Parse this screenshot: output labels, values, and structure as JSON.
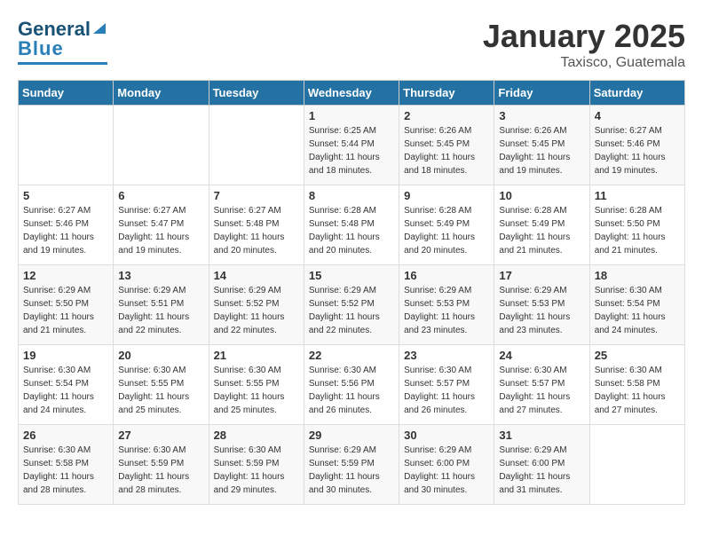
{
  "header": {
    "logo_general": "General",
    "logo_blue": "Blue",
    "title": "January 2025",
    "location": "Taxisco, Guatemala"
  },
  "days_of_week": [
    "Sunday",
    "Monday",
    "Tuesday",
    "Wednesday",
    "Thursday",
    "Friday",
    "Saturday"
  ],
  "weeks": [
    [
      {
        "day": "",
        "info": ""
      },
      {
        "day": "",
        "info": ""
      },
      {
        "day": "",
        "info": ""
      },
      {
        "day": "1",
        "info": "Sunrise: 6:25 AM\nSunset: 5:44 PM\nDaylight: 11 hours and 18 minutes."
      },
      {
        "day": "2",
        "info": "Sunrise: 6:26 AM\nSunset: 5:45 PM\nDaylight: 11 hours and 18 minutes."
      },
      {
        "day": "3",
        "info": "Sunrise: 6:26 AM\nSunset: 5:45 PM\nDaylight: 11 hours and 19 minutes."
      },
      {
        "day": "4",
        "info": "Sunrise: 6:27 AM\nSunset: 5:46 PM\nDaylight: 11 hours and 19 minutes."
      }
    ],
    [
      {
        "day": "5",
        "info": "Sunrise: 6:27 AM\nSunset: 5:46 PM\nDaylight: 11 hours and 19 minutes."
      },
      {
        "day": "6",
        "info": "Sunrise: 6:27 AM\nSunset: 5:47 PM\nDaylight: 11 hours and 19 minutes."
      },
      {
        "day": "7",
        "info": "Sunrise: 6:27 AM\nSunset: 5:48 PM\nDaylight: 11 hours and 20 minutes."
      },
      {
        "day": "8",
        "info": "Sunrise: 6:28 AM\nSunset: 5:48 PM\nDaylight: 11 hours and 20 minutes."
      },
      {
        "day": "9",
        "info": "Sunrise: 6:28 AM\nSunset: 5:49 PM\nDaylight: 11 hours and 20 minutes."
      },
      {
        "day": "10",
        "info": "Sunrise: 6:28 AM\nSunset: 5:49 PM\nDaylight: 11 hours and 21 minutes."
      },
      {
        "day": "11",
        "info": "Sunrise: 6:28 AM\nSunset: 5:50 PM\nDaylight: 11 hours and 21 minutes."
      }
    ],
    [
      {
        "day": "12",
        "info": "Sunrise: 6:29 AM\nSunset: 5:50 PM\nDaylight: 11 hours and 21 minutes."
      },
      {
        "day": "13",
        "info": "Sunrise: 6:29 AM\nSunset: 5:51 PM\nDaylight: 11 hours and 22 minutes."
      },
      {
        "day": "14",
        "info": "Sunrise: 6:29 AM\nSunset: 5:52 PM\nDaylight: 11 hours and 22 minutes."
      },
      {
        "day": "15",
        "info": "Sunrise: 6:29 AM\nSunset: 5:52 PM\nDaylight: 11 hours and 22 minutes."
      },
      {
        "day": "16",
        "info": "Sunrise: 6:29 AM\nSunset: 5:53 PM\nDaylight: 11 hours and 23 minutes."
      },
      {
        "day": "17",
        "info": "Sunrise: 6:29 AM\nSunset: 5:53 PM\nDaylight: 11 hours and 23 minutes."
      },
      {
        "day": "18",
        "info": "Sunrise: 6:30 AM\nSunset: 5:54 PM\nDaylight: 11 hours and 24 minutes."
      }
    ],
    [
      {
        "day": "19",
        "info": "Sunrise: 6:30 AM\nSunset: 5:54 PM\nDaylight: 11 hours and 24 minutes."
      },
      {
        "day": "20",
        "info": "Sunrise: 6:30 AM\nSunset: 5:55 PM\nDaylight: 11 hours and 25 minutes."
      },
      {
        "day": "21",
        "info": "Sunrise: 6:30 AM\nSunset: 5:55 PM\nDaylight: 11 hours and 25 minutes."
      },
      {
        "day": "22",
        "info": "Sunrise: 6:30 AM\nSunset: 5:56 PM\nDaylight: 11 hours and 26 minutes."
      },
      {
        "day": "23",
        "info": "Sunrise: 6:30 AM\nSunset: 5:57 PM\nDaylight: 11 hours and 26 minutes."
      },
      {
        "day": "24",
        "info": "Sunrise: 6:30 AM\nSunset: 5:57 PM\nDaylight: 11 hours and 27 minutes."
      },
      {
        "day": "25",
        "info": "Sunrise: 6:30 AM\nSunset: 5:58 PM\nDaylight: 11 hours and 27 minutes."
      }
    ],
    [
      {
        "day": "26",
        "info": "Sunrise: 6:30 AM\nSunset: 5:58 PM\nDaylight: 11 hours and 28 minutes."
      },
      {
        "day": "27",
        "info": "Sunrise: 6:30 AM\nSunset: 5:59 PM\nDaylight: 11 hours and 28 minutes."
      },
      {
        "day": "28",
        "info": "Sunrise: 6:30 AM\nSunset: 5:59 PM\nDaylight: 11 hours and 29 minutes."
      },
      {
        "day": "29",
        "info": "Sunrise: 6:29 AM\nSunset: 5:59 PM\nDaylight: 11 hours and 30 minutes."
      },
      {
        "day": "30",
        "info": "Sunrise: 6:29 AM\nSunset: 6:00 PM\nDaylight: 11 hours and 30 minutes."
      },
      {
        "day": "31",
        "info": "Sunrise: 6:29 AM\nSunset: 6:00 PM\nDaylight: 11 hours and 31 minutes."
      },
      {
        "day": "",
        "info": ""
      }
    ]
  ]
}
